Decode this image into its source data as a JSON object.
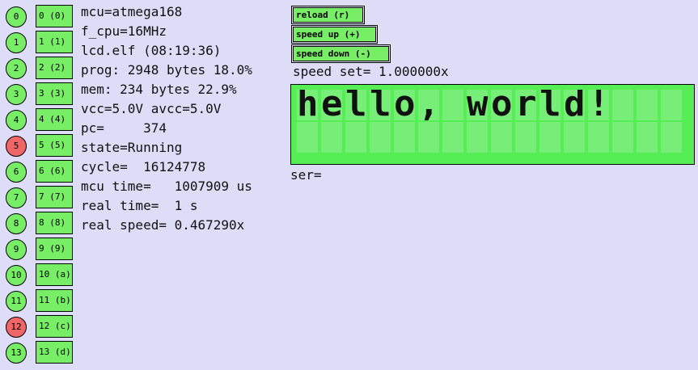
{
  "pins": [
    {
      "num": "0",
      "label": "0 (0)",
      "state": "on"
    },
    {
      "num": "1",
      "label": "1 (1)",
      "state": "on"
    },
    {
      "num": "2",
      "label": "2 (2)",
      "state": "on"
    },
    {
      "num": "3",
      "label": "3 (3)",
      "state": "on"
    },
    {
      "num": "4",
      "label": "4 (4)",
      "state": "on"
    },
    {
      "num": "5",
      "label": "5 (5)",
      "state": "off"
    },
    {
      "num": "6",
      "label": "6 (6)",
      "state": "on"
    },
    {
      "num": "7",
      "label": "7 (7)",
      "state": "on"
    },
    {
      "num": "8",
      "label": "8 (8)",
      "state": "on"
    },
    {
      "num": "9",
      "label": "9 (9)",
      "state": "on"
    },
    {
      "num": "10",
      "label": "10 (a)",
      "state": "on"
    },
    {
      "num": "11",
      "label": "11 (b)",
      "state": "on"
    },
    {
      "num": "12",
      "label": "12 (c)",
      "state": "off"
    },
    {
      "num": "13",
      "label": "13 (d)",
      "state": "on"
    }
  ],
  "info": {
    "mcu": "mcu=atmega168",
    "f_cpu": "f_cpu=16MHz",
    "file": "lcd.elf (08:19:36)",
    "prog": "prog: 2948 bytes 18.0%",
    "mem": "mem: 234 bytes 22.9%",
    "vcc": "vcc=5.0V avcc=5.0V",
    "pc": "pc=     374",
    "state": "state=Running",
    "cycle": "cycle=  16124778",
    "mcu_time": "mcu time=   1007909 us",
    "real_time": "real time=  1 s",
    "real_speed": "real speed= 0.467290x"
  },
  "controls": {
    "reload": "reload (r)",
    "speed_up": "speed up (+)",
    "speed_down": "speed down (-)",
    "speed_set": "speed set= 1.000000x"
  },
  "lcd": {
    "line1": "hello, world!",
    "line2": ""
  },
  "serial": {
    "label": "ser="
  },
  "colors": {
    "background": "#ddddf8",
    "pin_on": "#77ee66",
    "pin_off": "#ee6666",
    "lcd_bg": "#55ee55",
    "lcd_cell": "#77ee77"
  }
}
